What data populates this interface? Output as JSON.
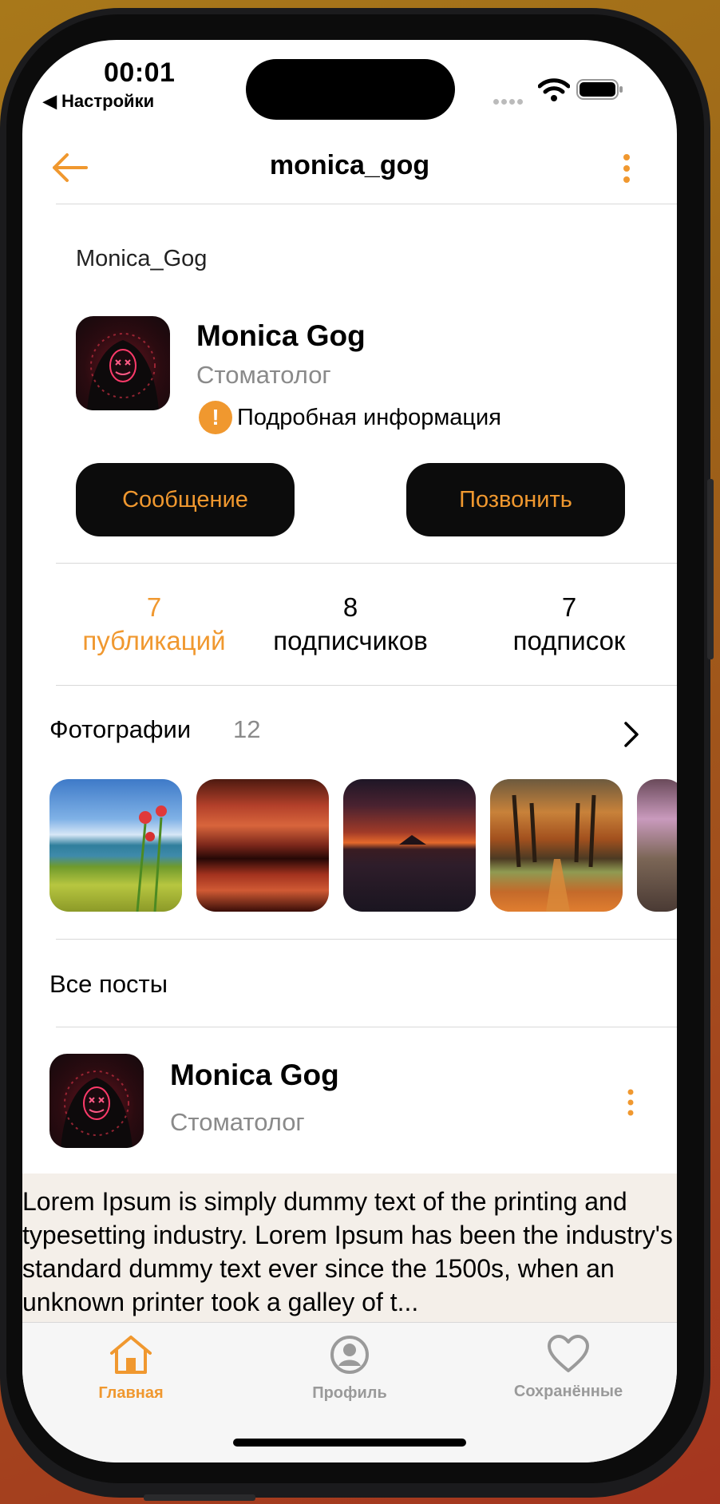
{
  "status_bar": {
    "time": "00:01",
    "back_app": "◀ Настройки"
  },
  "nav": {
    "title": "monica_gog"
  },
  "profile": {
    "username": "Monica_Gog",
    "name": "Monica Gog",
    "profession": "Стоматолог",
    "info_link": "Подробная информация",
    "info_icon": "!",
    "message_button": "Сообщение",
    "call_button": "Позвонить"
  },
  "stats": [
    {
      "count": "7",
      "label": "публикаций"
    },
    {
      "count": "8",
      "label": "подписчиков"
    },
    {
      "count": "7",
      "label": "подписок"
    }
  ],
  "photos": {
    "title": "Фотографии",
    "count": "12"
  },
  "all_posts": {
    "title": "Все посты"
  },
  "post": {
    "author": "Monica Gog",
    "profession": "Стоматолог",
    "text": "Lorem Ipsum is simply dummy text of the printing and typesetting industry. Lorem Ipsum has been the industry's standard dummy text ever since the 1500s, when an unknown printer took a galley of t..."
  },
  "tabbar": {
    "items": [
      {
        "label": "Главная",
        "icon": "home-icon",
        "active": true
      },
      {
        "label": "Профиль",
        "icon": "profile-icon",
        "active": false
      },
      {
        "label": "Сохранённые",
        "icon": "heart-icon",
        "active": false
      }
    ]
  },
  "colors": {
    "accent": "#f0982f",
    "button_bg": "#0c0c0c",
    "secondary_text": "#8a8a8a"
  }
}
